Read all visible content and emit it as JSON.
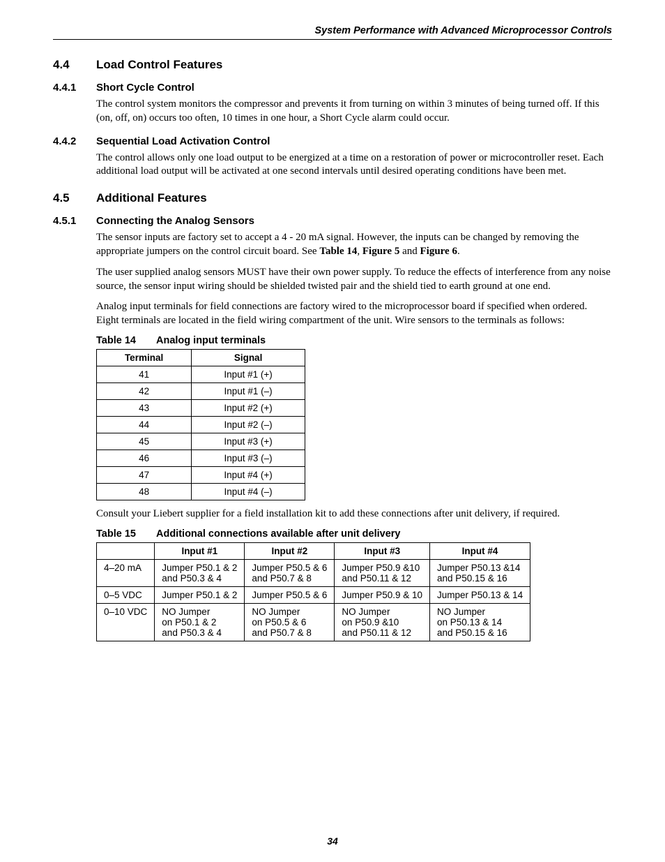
{
  "header": "System Performance with Advanced Microprocessor Controls",
  "page_number": "34",
  "s44": {
    "num": "4.4",
    "title": "Load Control Features",
    "s441": {
      "num": "4.4.1",
      "title": "Short Cycle Control",
      "p1": "The control system monitors the compressor and prevents it from turning on within 3 minutes of being turned off. If this (on, off, on) occurs too often, 10 times in one hour, a Short Cycle alarm could occur."
    },
    "s442": {
      "num": "4.4.2",
      "title": "Sequential Load Activation Control",
      "p1": "The control allows only one load output to be energized at a time on a restoration of power or microcontroller reset. Each additional load output will be activated at one second intervals until desired operating conditions have been met."
    }
  },
  "s45": {
    "num": "4.5",
    "title": "Additional Features",
    "s451": {
      "num": "4.5.1",
      "title": "Connecting the Analog Sensors",
      "p1a": "The sensor inputs are factory set to accept a 4 - 20 mA signal. However, the inputs can be changed by removing the appropriate jumpers on the control circuit board. See ",
      "p1_t14": "Table 14",
      "p1_sep1": ", ",
      "p1_f5": "Figure 5",
      "p1_sep2": " and ",
      "p1_f6": "Figure 6",
      "p1b": ".",
      "p2": "The user supplied analog sensors MUST have their own power supply. To reduce the effects of interference from any noise source, the sensor input wiring should be shielded twisted pair and the shield tied to earth ground at one end.",
      "p3": "Analog input terminals for field connections are factory wired to the microprocessor board if specified when ordered. Eight terminals are located in the field wiring compartment of the unit. Wire sensors to the terminals as follows:",
      "p4": "Consult your Liebert supplier for a field installation kit to add these connections after unit delivery, if required."
    }
  },
  "table14": {
    "label": "Table 14",
    "title": "Analog input terminals",
    "col1": "Terminal",
    "col2": "Signal",
    "rows": [
      {
        "t": "41",
        "s": "Input #1 (+)"
      },
      {
        "t": "42",
        "s": "Input #1 (–)"
      },
      {
        "t": "43",
        "s": "Input #2 (+)"
      },
      {
        "t": "44",
        "s": "Input #2 (–)"
      },
      {
        "t": "45",
        "s": "Input #3 (+)"
      },
      {
        "t": "46",
        "s": "Input #3 (–)"
      },
      {
        "t": "47",
        "s": "Input #4 (+)"
      },
      {
        "t": "48",
        "s": "Input #4 (–)"
      }
    ]
  },
  "table15": {
    "label": "Table 15",
    "title": "Additional connections available after unit delivery",
    "h_blank": "",
    "h1": "Input #1",
    "h2": "Input #2",
    "h3": "Input #3",
    "h4": "Input #4",
    "rows": [
      {
        "r": "4–20 mA",
        "c1": "Jumper P50.1 & 2\nand P50.3 & 4",
        "c2": "Jumper P50.5 & 6\nand P50.7 & 8",
        "c3": "Jumper P50.9 &10\nand P50.11 & 12",
        "c4": "Jumper P50.13 &14\nand P50.15 & 16"
      },
      {
        "r": "0–5 VDC",
        "c1": "Jumper P50.1 & 2",
        "c2": "Jumper P50.5 & 6",
        "c3": "Jumper P50.9 & 10",
        "c4": "Jumper P50.13 & 14"
      },
      {
        "r": "0–10 VDC",
        "c1": "NO Jumper\non P50.1 & 2\nand P50.3 & 4",
        "c2": "NO Jumper\non P50.5 & 6\nand P50.7 & 8",
        "c3": "NO Jumper\non P50.9 &10\nand P50.11 & 12",
        "c4": "NO Jumper\non P50.13 & 14\nand P50.15 & 16"
      }
    ]
  }
}
